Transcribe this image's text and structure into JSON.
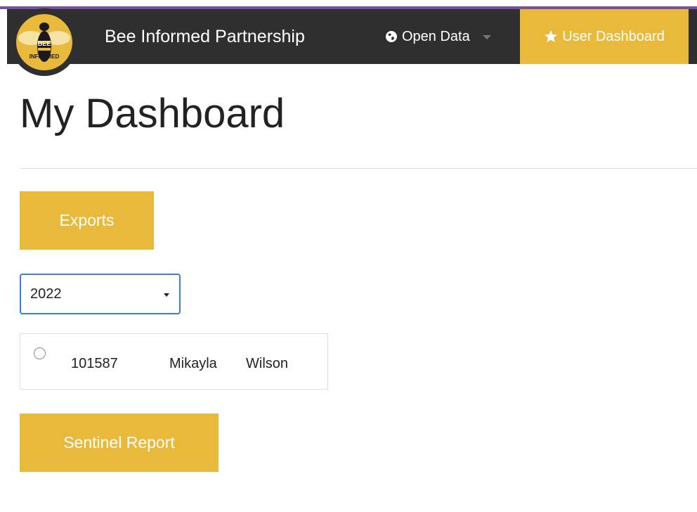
{
  "navbar": {
    "logo_text_top": "BEE",
    "logo_text_bottom": "INFORMED",
    "brand": "Bee Informed Partnership",
    "open_data_label": "Open Data",
    "open_data_icon": "globe-icon",
    "user_dashboard_label": "User Dashboard",
    "user_dashboard_icon": "star-icon"
  },
  "page": {
    "title": "My Dashboard"
  },
  "buttons": {
    "exports_label": "Exports",
    "sentinel_report_label": "Sentinel Report"
  },
  "year_select": {
    "value": "2022"
  },
  "record": {
    "id": "101587",
    "first_name": "Mikayla",
    "last_name": "Wilson"
  },
  "colors": {
    "navbar_bg": "#2f2f2f",
    "accent_gold": "#e8b93a",
    "top_strip": "#7b4fa0",
    "select_border": "#3c7bd6"
  }
}
